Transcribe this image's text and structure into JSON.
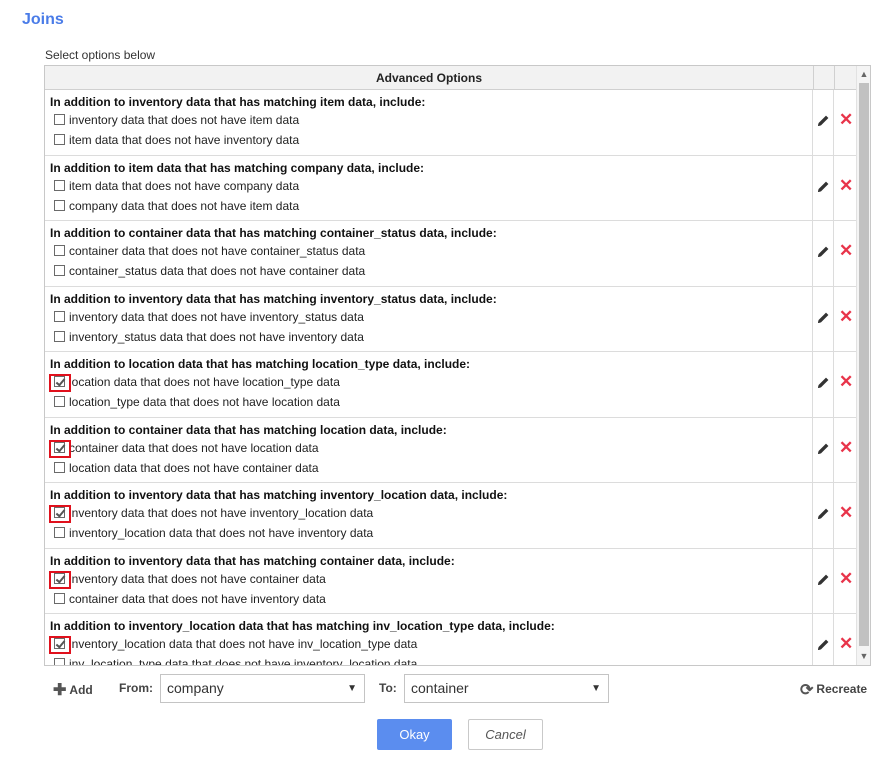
{
  "dialog": {
    "title": "Joins",
    "subtitle": "Select options below"
  },
  "table": {
    "header": "Advanced Options",
    "rows": [
      {
        "heading": "In addition to inventory data that has matching item data, include:",
        "options": [
          {
            "label": "inventory data that does not have item data",
            "checked": false
          },
          {
            "label": "item data that does not have inventory data",
            "checked": false
          }
        ]
      },
      {
        "heading": "In addition to item data that has matching company data, include:",
        "options": [
          {
            "label": "item data that does not have company data",
            "checked": false
          },
          {
            "label": "company data that does not have item data",
            "checked": false
          }
        ]
      },
      {
        "heading": "In addition to container data that has matching container_status data, include:",
        "options": [
          {
            "label": "container data that does not have container_status data",
            "checked": false
          },
          {
            "label": "container_status data that does not have container data",
            "checked": false
          }
        ]
      },
      {
        "heading": "In addition to inventory data that has matching inventory_status data, include:",
        "options": [
          {
            "label": "inventory data that does not have inventory_status data",
            "checked": false
          },
          {
            "label": "inventory_status data that does not have inventory data",
            "checked": false
          }
        ]
      },
      {
        "heading": "In addition to location data that has matching location_type data, include:",
        "options": [
          {
            "label": "location data that does not have location_type data",
            "checked": true
          },
          {
            "label": "location_type data that does not have location data",
            "checked": false
          }
        ]
      },
      {
        "heading": "In addition to container data that has matching location data, include:",
        "options": [
          {
            "label": "container data that does not have location data",
            "checked": true
          },
          {
            "label": "location data that does not have container data",
            "checked": false
          }
        ]
      },
      {
        "heading": "In addition to inventory data that has matching inventory_location data, include:",
        "options": [
          {
            "label": "inventory data that does not have inventory_location data",
            "checked": true
          },
          {
            "label": "inventory_location data that does not have inventory data",
            "checked": false
          }
        ]
      },
      {
        "heading": "In addition to inventory data that has matching container data, include:",
        "options": [
          {
            "label": "inventory data that does not have container data",
            "checked": true
          },
          {
            "label": "container data that does not have inventory data",
            "checked": false
          }
        ]
      },
      {
        "heading": "In addition to inventory_location data that has matching inv_location_type data, include:",
        "options": [
          {
            "label": "inventory_location data that does not have inv_location_type data",
            "checked": true
          },
          {
            "label": "inv_location_type data that does not have inventory_location data",
            "checked": false
          }
        ]
      }
    ]
  },
  "toolbar": {
    "add_label": "Add",
    "from_label": "From:",
    "from_value": "company",
    "to_label": "To:",
    "to_value": "container",
    "recreate_label": "Recreate"
  },
  "buttons": {
    "okay": "Okay",
    "cancel": "Cancel"
  },
  "colors": {
    "title": "#4a7ce8",
    "primary_button": "#5b8def",
    "delete_icon": "#e8344a",
    "highlight": "#e0101c"
  },
  "icons": {
    "edit": "pencil-icon",
    "delete": "close-icon",
    "add": "plus-icon",
    "recreate": "refresh-icon"
  }
}
